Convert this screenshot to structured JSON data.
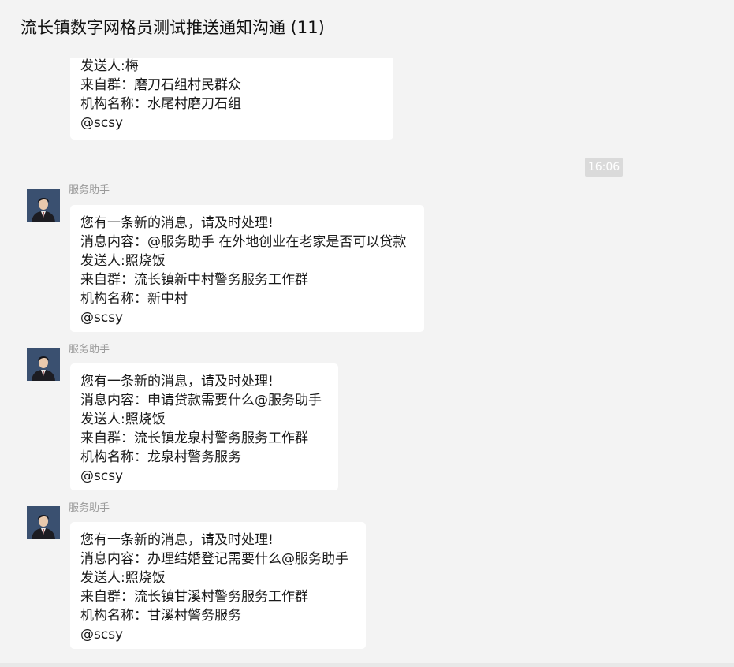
{
  "header": {
    "title": "流长镇数字网格员测试推送通知沟通 (11)"
  },
  "partial_message": {
    "lines": [
      "发送人:梅",
      "来自群：磨刀石组村民群众",
      "机构名称：水尾村磨刀石组",
      "@scsy"
    ]
  },
  "time_badge": "16:06",
  "messages": [
    {
      "sender": "服务助手",
      "lines": [
        "您有一条新的消息，请及时处理!",
        "消息内容：@服务助手 在外地创业在老家是否可以贷款",
        "发送人:照烧饭",
        "来自群：流长镇新中村警务服务工作群",
        "机构名称：新中村",
        "@scsy"
      ]
    },
    {
      "sender": "服务助手",
      "lines": [
        "您有一条新的消息，请及时处理!",
        "消息内容：申请贷款需要什么@服务助手",
        "发送人:照烧饭",
        "来自群：流长镇龙泉村警务服务工作群",
        "机构名称：龙泉村警务服务",
        "@scsy"
      ]
    },
    {
      "sender": "服务助手",
      "lines": [
        "您有一条新的消息，请及时处理!",
        "消息内容：办理结婚登记需要什么@服务助手",
        "发送人:照烧饭",
        "来自群：流长镇甘溪村警务服务工作群",
        "机构名称：甘溪村警务服务",
        "@scsy"
      ]
    }
  ]
}
